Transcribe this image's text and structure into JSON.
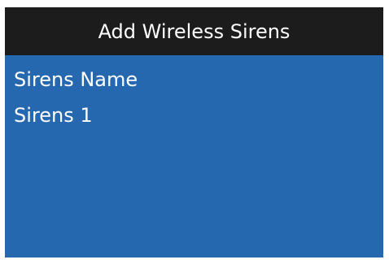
{
  "title": "Add Wireless Sirens",
  "form": {
    "label": "Sirens Name",
    "value": "Sirens 1"
  },
  "colors": {
    "title_bg": "#1c1c1c",
    "body_bg": "#2568b0",
    "text": "#ffffff"
  }
}
